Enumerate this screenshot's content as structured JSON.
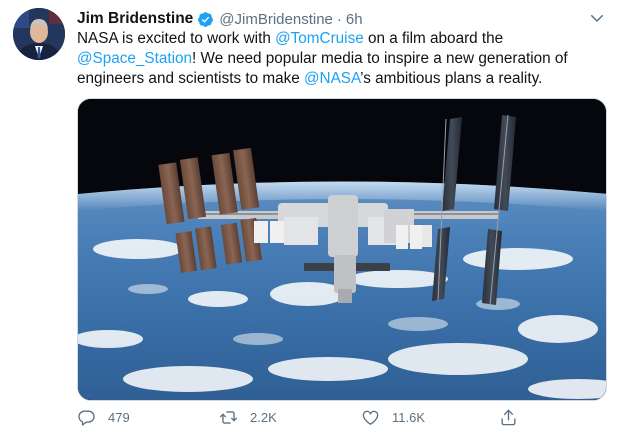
{
  "tweet": {
    "display_name": "Jim Bridenstine",
    "handle": "@JimBridenstine",
    "separator": "·",
    "time": "6h",
    "text": {
      "line1": {
        "a": "NASA is excited to work with ",
        "m1": "@TomCruise",
        "b": " on a film aboard the"
      },
      "line2": {
        "m2": "@Space_Station",
        "c": "! We need popular media to inspire a new generation of"
      },
      "line3": {
        "d": "engineers and scientists to make ",
        "m3": "@NASA",
        "e": "’s ambitious plans a reality."
      }
    },
    "media_alt": "International Space Station orbiting above Earth",
    "actions": {
      "reply_count": "479",
      "retweet_count": "2.2K",
      "like_count": "11.6K"
    }
  },
  "colors": {
    "link": "#1da1f2",
    "secondary_text": "#5b7083",
    "verified_badge": "#1da1f2"
  },
  "icons": [
    "verified-badge-icon",
    "chevron-down-icon",
    "reply-icon",
    "retweet-icon",
    "like-icon",
    "share-icon"
  ]
}
